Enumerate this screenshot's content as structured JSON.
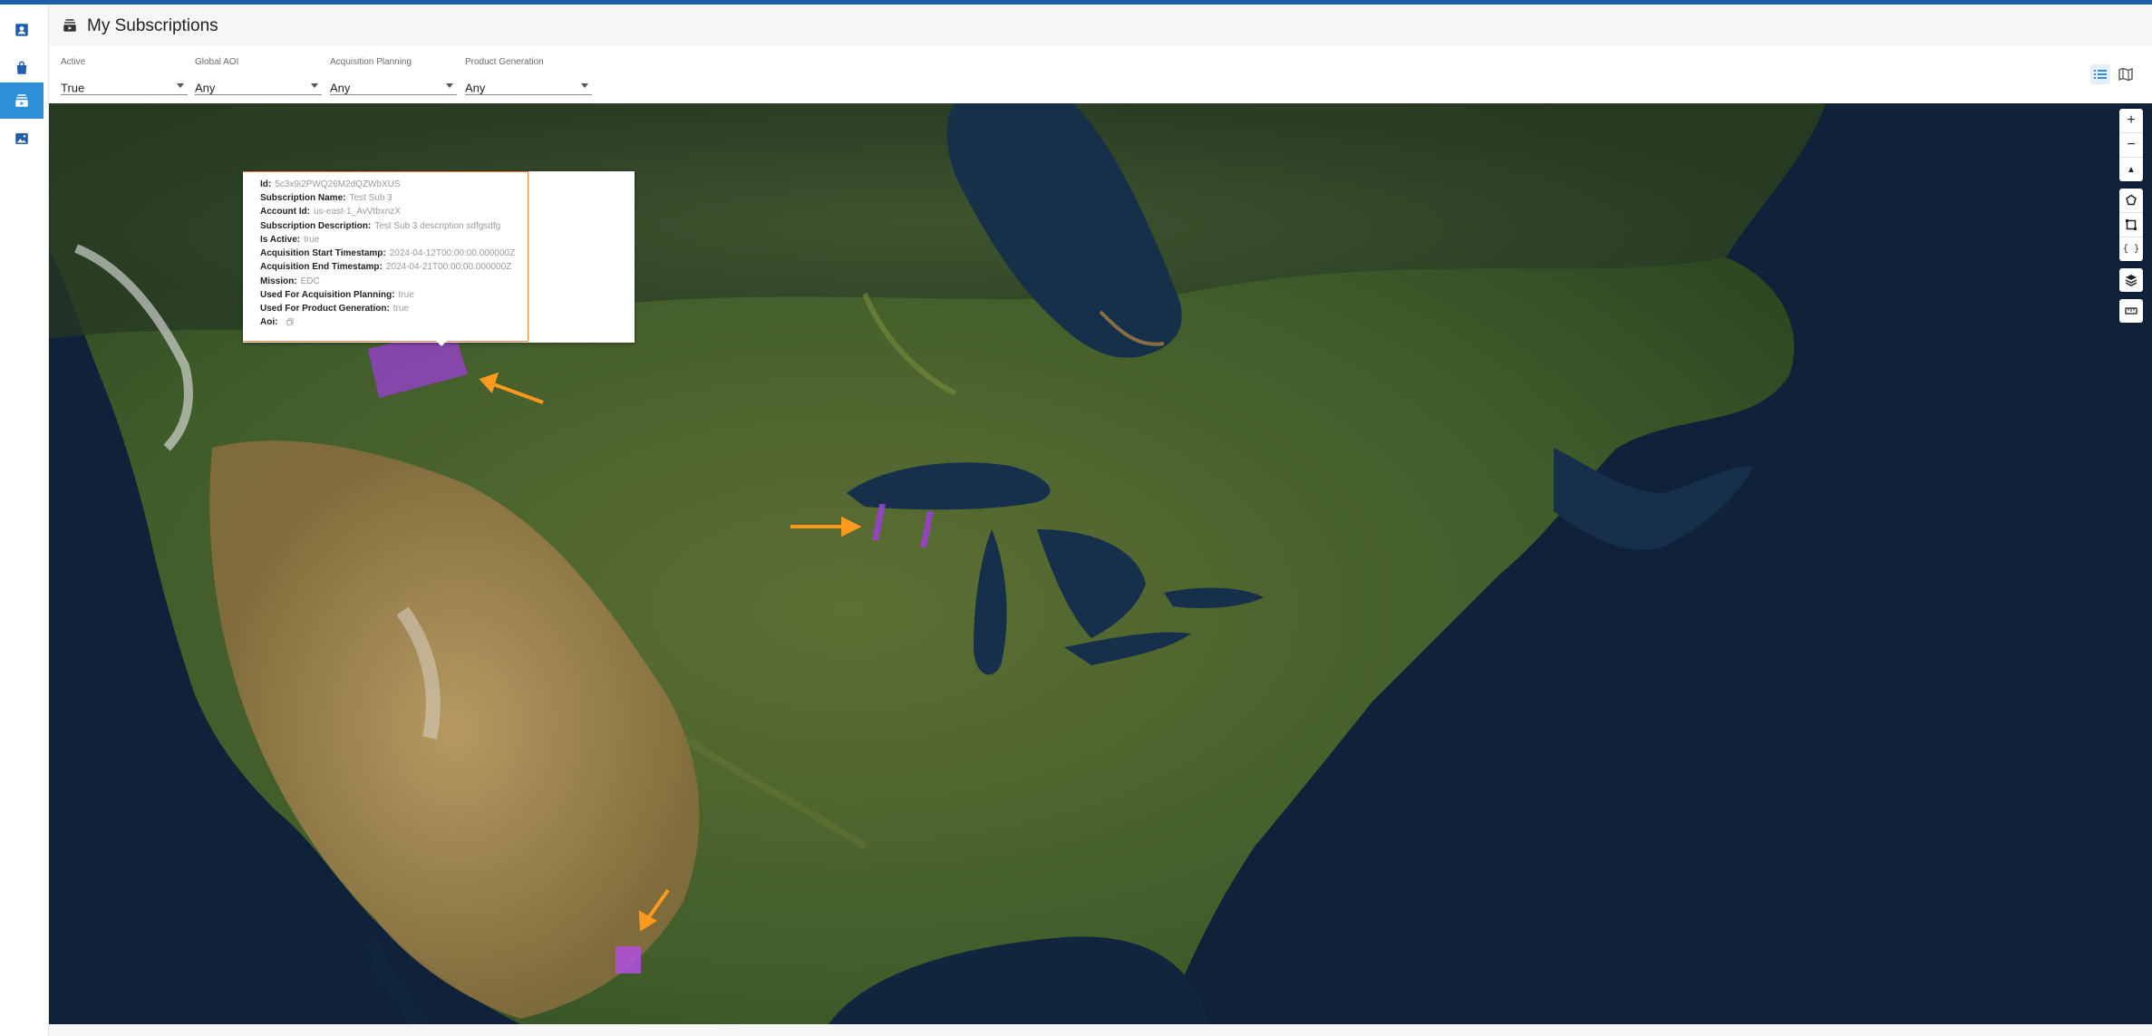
{
  "app": {
    "title": "My Subscriptions"
  },
  "filters": [
    {
      "label": "Active",
      "value": "True"
    },
    {
      "label": "Global AOI",
      "value": "Any"
    },
    {
      "label": "Acquisition Planning",
      "value": "Any"
    },
    {
      "label": "Product Generation",
      "value": "Any"
    }
  ],
  "sidebar": {
    "items": [
      {
        "icon": "account-icon",
        "active": false
      },
      {
        "icon": "shopping-bag-icon",
        "active": false
      },
      {
        "icon": "subscriptions-icon",
        "active": true
      },
      {
        "icon": "image-icon",
        "active": false
      }
    ]
  },
  "view_toggles": [
    {
      "icon": "list-view-icon",
      "active": true
    },
    {
      "icon": "map-view-icon",
      "active": false
    }
  ],
  "map_controls": {
    "zoom_in": "+",
    "zoom_out": "−",
    "reset_north": "▲",
    "geojson": "{ }"
  },
  "popup": {
    "fields": [
      {
        "label": "Id:",
        "value": "5c3x9i2PWQ26M2dQZWbXUS"
      },
      {
        "label": "Subscription Name:",
        "value": "Test Sub 3"
      },
      {
        "label": "Account Id:",
        "value": "us-east-1_AvVtbxnzX"
      },
      {
        "label": "Subscription Description:",
        "value": "Test Sub 3 description sdfgsdfg"
      },
      {
        "label": "Is Active:",
        "value": "true"
      },
      {
        "label": "Acquisition Start Timestamp:",
        "value": "2024-04-12T00:00:00.000000Z"
      },
      {
        "label": "Acquisition End Timestamp:",
        "value": "2024-04-21T00:00:00.000000Z"
      },
      {
        "label": "Mission:",
        "value": "EDC"
      },
      {
        "label": "Used For Acquisition Planning:",
        "value": "true"
      },
      {
        "label": "Used For Product Generation:",
        "value": "true"
      },
      {
        "label": "Aoi:",
        "value": ""
      }
    ]
  },
  "colors": {
    "accent": "#2f8fd8",
    "aoi_fill": "#9b3fd6",
    "annotation_arrow": "#ff9a1f",
    "popup_border": "#ff7a3d"
  }
}
